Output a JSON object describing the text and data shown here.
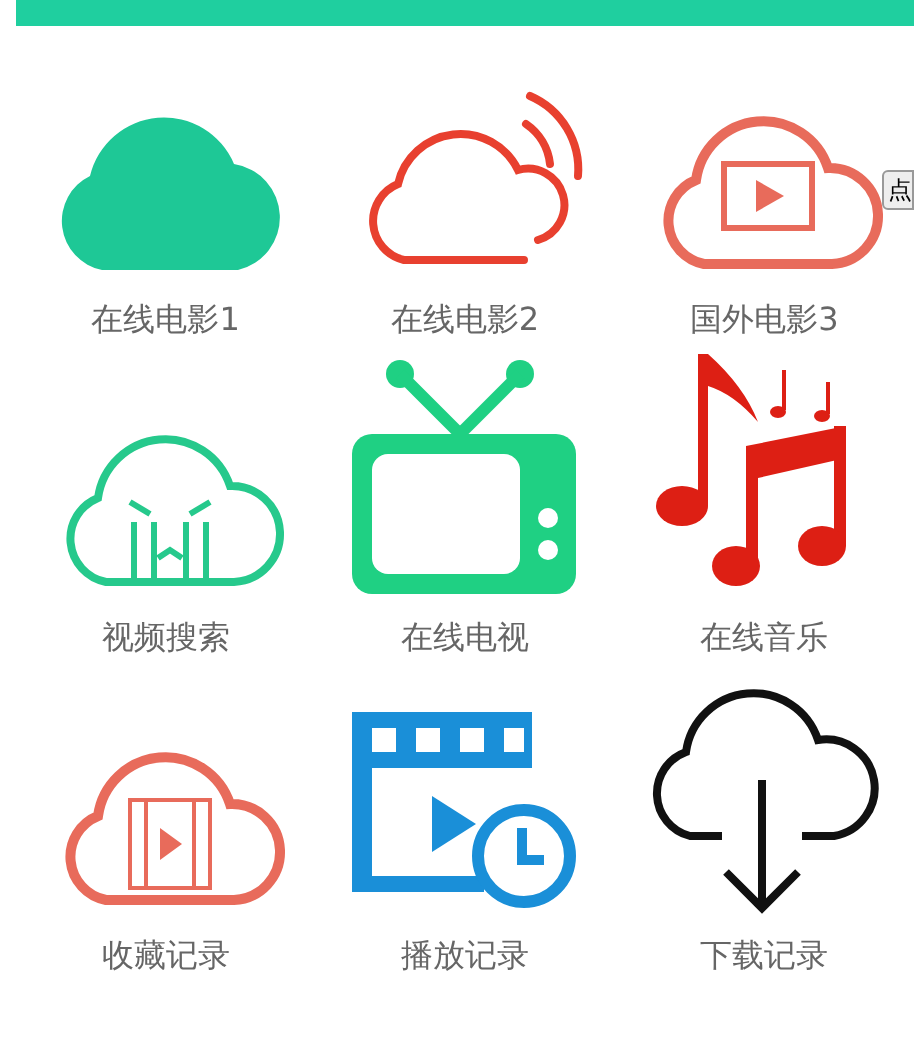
{
  "top_bar": {
    "color": "#1fcf9f"
  },
  "side_tab": {
    "label": "点"
  },
  "grid": [
    {
      "label": "在线电影1",
      "kind": "cloud-solid"
    },
    {
      "label": "在线电影2",
      "kind": "cloud-signal"
    },
    {
      "label": "国外电影3",
      "kind": "cloud-play"
    },
    {
      "label": "视频搜索",
      "kind": "cloud-crying"
    },
    {
      "label": "在线电视",
      "kind": "tv"
    },
    {
      "label": "在线音乐",
      "kind": "music"
    },
    {
      "label": "收藏记录",
      "kind": "cloud-film"
    },
    {
      "label": "播放记录",
      "kind": "video-clock"
    },
    {
      "label": "下载记录",
      "kind": "cloud-download"
    }
  ]
}
